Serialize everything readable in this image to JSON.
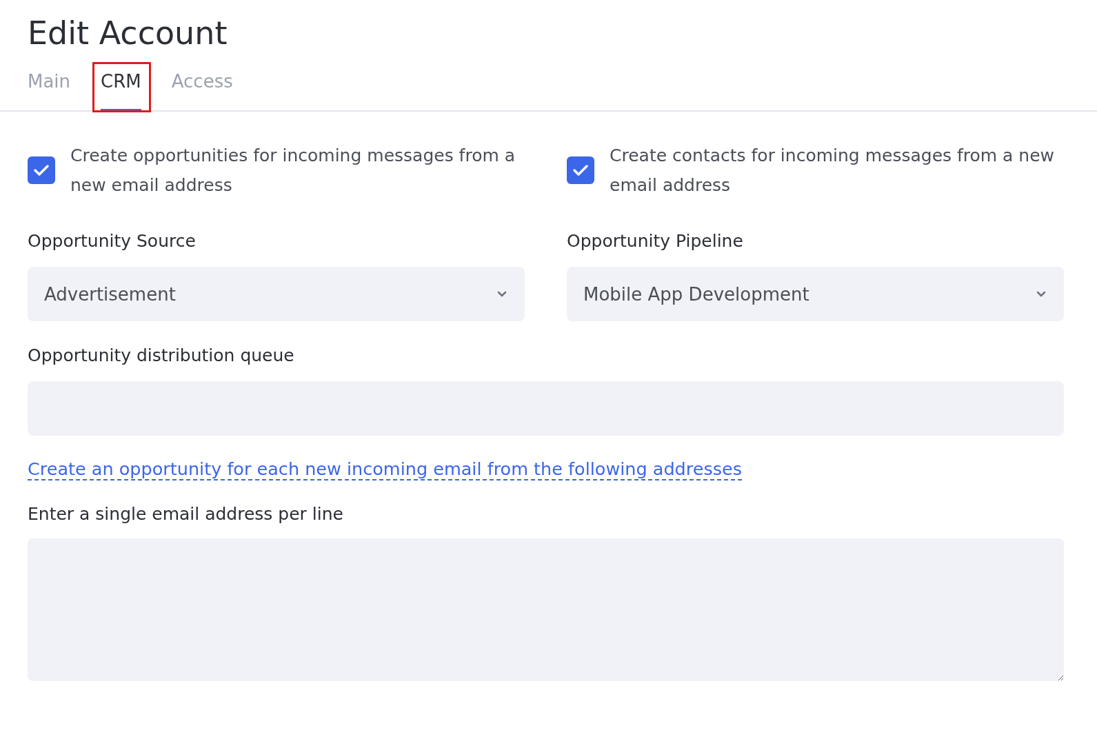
{
  "page": {
    "title": "Edit Account"
  },
  "tabs": [
    {
      "label": "Main",
      "selected": false,
      "highlighted": false
    },
    {
      "label": "CRM",
      "selected": true,
      "highlighted": true
    },
    {
      "label": "Access",
      "selected": false,
      "highlighted": false
    }
  ],
  "checkboxes": [
    {
      "label": "Create opportunities for incoming messages from a new email address",
      "checked": true
    },
    {
      "label": "Create contacts for incoming messages from a new email address",
      "checked": true
    }
  ],
  "selects": [
    {
      "label": "Opportunity Source",
      "value": "Advertisement"
    },
    {
      "label": "Opportunity Pipeline",
      "value": "Mobile App Development"
    }
  ],
  "queue": {
    "label": "Opportunity distribution queue"
  },
  "link": "Create an opportunity for each new incoming email from the following addresses",
  "emails": {
    "label": "Enter a single email address per line"
  }
}
